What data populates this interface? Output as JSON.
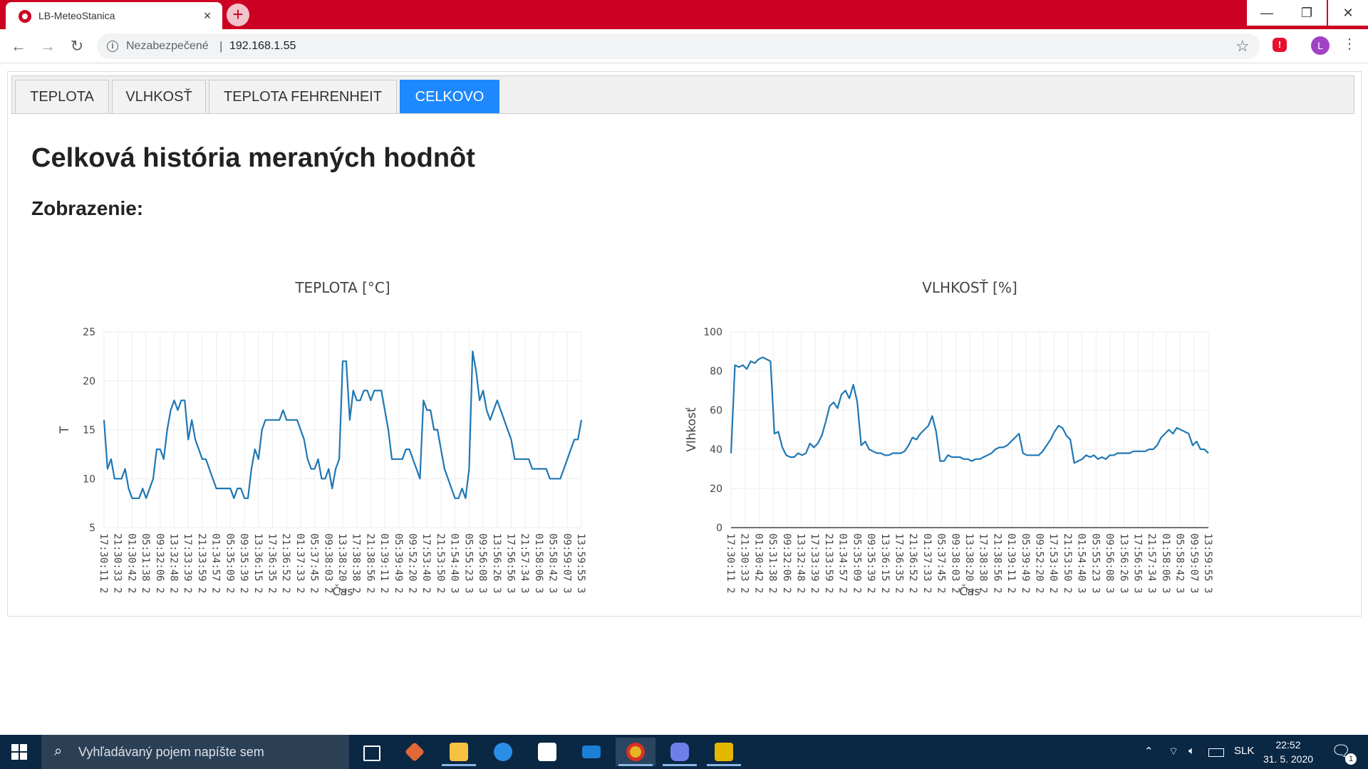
{
  "browser": {
    "tab_title": "LB-MeteoStanica",
    "close_glyph": "×",
    "new_tab_glyph": "+",
    "security_label": "Nezabezpečené",
    "separator": "|",
    "url": "192.168.1.55",
    "profile_initial": "L",
    "window_controls": {
      "minimize": "—",
      "maximize": "❐",
      "close": "✕"
    }
  },
  "page": {
    "tabs": [
      {
        "label": "TEPLOTA",
        "active": false
      },
      {
        "label": "VLHKOSŤ",
        "active": false
      },
      {
        "label": "TEPLOTA FEHRENHEIT",
        "active": false
      },
      {
        "label": "CELKOVO",
        "active": true
      }
    ],
    "heading": "Celková história meraných hodnôt",
    "subheading": "Zobrazenie:"
  },
  "taskbar": {
    "search_placeholder": "Vyhľadávaný pojem napíšte sem",
    "language": "SLK",
    "time": "22:52",
    "date": "31. 5. 2020",
    "notification_count": "1",
    "apps": [
      "task-view",
      "matlab",
      "file-explorer",
      "edge",
      "store",
      "mail",
      "chrome",
      "discord",
      "app"
    ]
  },
  "colors": {
    "browser_red": "#cc0022",
    "active_tab_blue": "#1e88ff",
    "series_blue": "#1f77b4",
    "taskbar": "#0a2744"
  },
  "chart_data": [
    {
      "type": "line",
      "title": "TEPLOTA [°C]",
      "xlabel": "Čas",
      "ylabel": "T",
      "ylim": [
        5,
        25
      ],
      "y_ticks": [
        5,
        10,
        15,
        20,
        25
      ],
      "x_tick_labels": [
        "17:30:11 2",
        "21:30:33 2",
        "01:30:42 2",
        "05:31:38 2",
        "09:32:06 2",
        "13:32:48 2",
        "17:33:39 2",
        "21:33:59 2",
        "01:34:57 2",
        "05:35:09 2",
        "09:35:39 2",
        "13:36:15 2",
        "17:36:35 2",
        "21:36:52 2",
        "01:37:33 2",
        "05:37:45 2",
        "09:38:03 2",
        "13:38:20 2",
        "17:38:38 2",
        "21:38:56 2",
        "01:39:11 2",
        "05:39:49 2",
        "09:52:20 2",
        "17:53:40 2",
        "21:53:50 2",
        "01:54:40 3",
        "05:55:23 3",
        "09:56:08 3",
        "13:56:26 3",
        "17:56:56 3",
        "21:57:34 3",
        "01:58:06 3",
        "05:58:42 3",
        "09:59:07 3",
        "13:59:55 3"
      ],
      "series": [
        {
          "values": [
            16,
            11,
            12,
            10,
            10,
            10,
            11,
            9,
            8,
            8,
            8,
            9,
            8,
            9,
            10,
            13,
            13,
            12,
            15,
            17,
            18,
            17,
            18,
            18,
            14,
            16,
            14,
            13,
            12,
            12,
            11,
            10,
            9,
            9,
            9,
            9,
            9,
            8,
            9,
            9,
            8,
            8,
            11,
            13,
            12,
            15,
            16,
            16,
            16,
            16,
            16,
            17,
            16,
            16,
            16,
            16,
            15,
            14,
            12,
            11,
            11,
            12,
            10,
            10,
            11,
            9,
            11,
            12,
            22,
            22,
            16,
            19,
            18,
            18,
            19,
            19,
            18,
            19,
            19,
            19,
            17,
            15,
            12,
            12,
            12,
            12,
            13,
            13,
            12,
            11,
            10,
            18,
            17,
            17,
            15,
            15,
            13,
            11,
            10,
            9,
            8,
            8,
            9,
            8,
            11,
            23,
            21,
            18,
            19,
            17,
            16,
            17,
            18,
            17,
            16,
            15,
            14,
            12,
            12,
            12,
            12,
            12,
            11,
            11,
            11,
            11,
            11,
            10,
            10,
            10,
            10,
            11,
            12,
            13,
            14,
            14,
            16
          ]
        }
      ]
    },
    {
      "type": "line",
      "title": "VLHKOSŤ [%]",
      "xlabel": "Čas",
      "ylabel": "Vlhkosť",
      "ylim": [
        0,
        100
      ],
      "y_ticks": [
        0,
        20,
        40,
        60,
        80,
        100
      ],
      "x_tick_labels": [
        "17:30:11 2",
        "21:30:33 2",
        "01:30:42 2",
        "05:31:38 2",
        "09:32:06 2",
        "13:32:48 2",
        "17:33:39 2",
        "21:33:59 2",
        "01:34:57 2",
        "05:35:09 2",
        "09:35:39 2",
        "13:36:15 2",
        "17:36:35 2",
        "21:36:52 2",
        "01:37:33 2",
        "05:37:45 2",
        "09:38:03 2",
        "13:38:20 2",
        "17:38:38 2",
        "21:38:56 2",
        "01:39:11 2",
        "05:39:49 2",
        "09:52:20 2",
        "17:53:40 2",
        "21:53:50 2",
        "01:54:40 3",
        "05:55:23 3",
        "09:56:08 3",
        "13:56:26 3",
        "17:56:56 3",
        "21:57:34 3",
        "01:58:06 3",
        "05:58:42 3",
        "09:59:07 3",
        "13:59:55 3"
      ],
      "series": [
        {
          "values": [
            38,
            83,
            82,
            83,
            81,
            85,
            84,
            86,
            87,
            86,
            85,
            48,
            49,
            41,
            37,
            36,
            36,
            38,
            37,
            38,
            43,
            41,
            43,
            47,
            54,
            62,
            64,
            61,
            68,
            70,
            66,
            73,
            64,
            42,
            44,
            40,
            39,
            38,
            38,
            37,
            37,
            38,
            38,
            38,
            39,
            42,
            46,
            45,
            48,
            50,
            52,
            57,
            49,
            34,
            34,
            37,
            36,
            36,
            36,
            35,
            35,
            34,
            35,
            35,
            36,
            37,
            38,
            40,
            41,
            41,
            42,
            44,
            46,
            48,
            38,
            37,
            37,
            37,
            37,
            39,
            42,
            45,
            49,
            52,
            51,
            47,
            45,
            33,
            34,
            35,
            37,
            36,
            37,
            35,
            36,
            35,
            37,
            37,
            38,
            38,
            38,
            38,
            39,
            39,
            39,
            39,
            40,
            40,
            42,
            46,
            48,
            50,
            48,
            51,
            50,
            49,
            48,
            42,
            44,
            40,
            40,
            38
          ]
        }
      ]
    }
  ]
}
